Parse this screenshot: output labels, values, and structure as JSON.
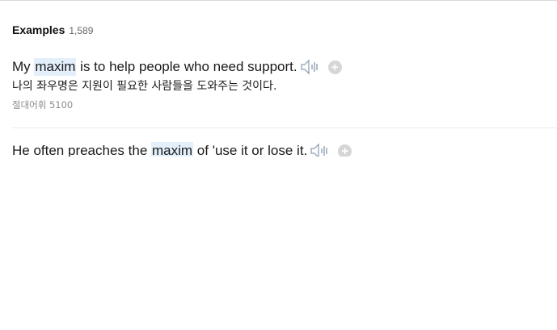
{
  "section": {
    "title": "Examples",
    "count": "1,589"
  },
  "examples": [
    {
      "before": "My ",
      "highlight": "maxim",
      "after": " is to help people who need support.",
      "translation": "나의 좌우명은 지원이 필요한 사람들을 도와주는 것이다.",
      "source": "절대어휘 5100",
      "speaker_icon": "speaker-icon",
      "add_icon": "plus-icon",
      "add_label": "+"
    },
    {
      "before": "He often preaches the ",
      "highlight": "maxim",
      "after": " of 'use it or lose it.",
      "speaker_icon": "speaker-icon",
      "add_icon": "plus-icon",
      "add_label": "+"
    }
  ],
  "colors": {
    "highlight": "#e3f0fb",
    "add_button": "#d6d6d6",
    "muted_text": "#8c8c8c"
  }
}
